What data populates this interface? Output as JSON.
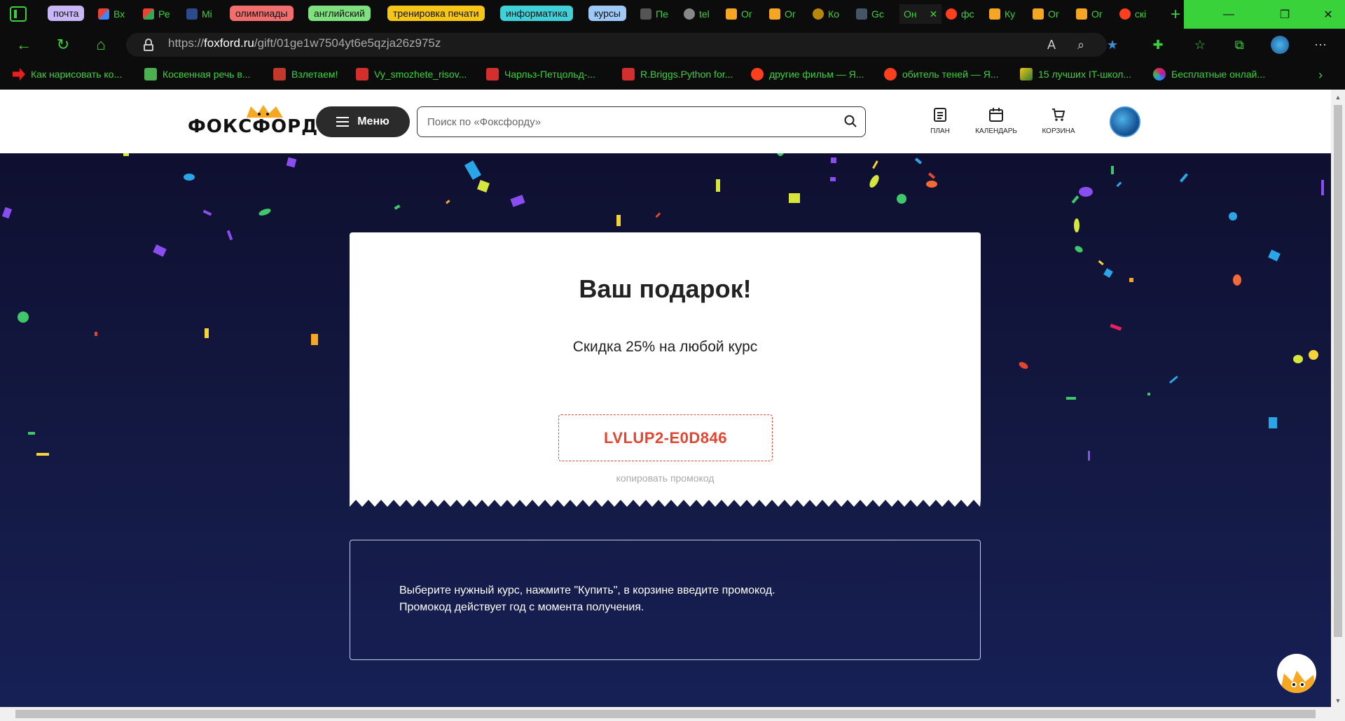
{
  "browser": {
    "tab_groups": [
      {
        "label": "почта",
        "color": "#c8b6f5"
      },
      {
        "label": "олимпиады",
        "color": "#f06e6e"
      },
      {
        "label": "английский",
        "color": "#7fe07f"
      },
      {
        "label": "тренировка печати",
        "color": "#f5c518"
      },
      {
        "label": "информатика",
        "color": "#3fd0d8"
      },
      {
        "label": "курсы",
        "color": "#9ec8f5"
      }
    ],
    "tabs": [
      {
        "label": "Вх",
        "icon": "gmail-icon"
      },
      {
        "label": "Ре",
        "icon": "gmail-icon"
      },
      {
        "label": "Мі",
        "icon": "site-icon"
      },
      {
        "label": "Пе",
        "icon": "page-icon"
      },
      {
        "label": "tel",
        "icon": "link-icon"
      },
      {
        "label": "Ог",
        "icon": "foxford-icon"
      },
      {
        "label": "Ог",
        "icon": "foxford-icon"
      },
      {
        "label": "Ко",
        "icon": "infinity-icon"
      },
      {
        "label": "Gc",
        "icon": "page-icon"
      },
      {
        "label": "Он",
        "icon": "active-tab"
      },
      {
        "label": "фс",
        "icon": "yandex-icon"
      },
      {
        "label": "Ку",
        "icon": "foxford-icon"
      },
      {
        "label": "Ог",
        "icon": "foxford-icon"
      },
      {
        "label": "Ог",
        "icon": "foxford-icon"
      },
      {
        "label": "скі",
        "icon": "yandex-icon"
      }
    ],
    "url_prefix": "https://",
    "url_domain": "foxford.ru",
    "url_path": "/gift/01ge1w7504yt6e5qzja26z975z",
    "bookmarks": [
      {
        "label": "Как нарисовать ко...",
        "icon": "red-arrow-icon"
      },
      {
        "label": "Косвенная речь в...",
        "icon": "ed-icon"
      },
      {
        "label": "Взлетаем!",
        "icon": "grid-icon"
      },
      {
        "label": "Vy_smozhete_risov...",
        "icon": "pdf-icon"
      },
      {
        "label": "Чарльз-Петцольд-...",
        "icon": "pdf-icon"
      },
      {
        "label": "R.Briggs.Python for...",
        "icon": "pdf-icon"
      },
      {
        "label": "другие фильм — Я...",
        "icon": "yandex-icon"
      },
      {
        "label": "обитель теней — Я...",
        "icon": "yandex-icon"
      },
      {
        "label": "15 лучших IT-школ...",
        "icon": "feather-icon"
      },
      {
        "label": "Бесплатные онлай...",
        "icon": "colorful-icon"
      }
    ]
  },
  "site": {
    "logo_text": "ФОКСФОРД",
    "menu_label": "Меню",
    "search_placeholder": "Поиск по «Фоксфорду»",
    "header_items": {
      "plan": "ПЛАН",
      "calendar": "КАЛЕНДАРЬ",
      "cart": "КОРЗИНА"
    }
  },
  "gift": {
    "title": "Ваш подарок!",
    "subtitle": "Скидка 25% на любой курс",
    "promo_code": "LVLUP2-E0D846",
    "copy_label": "копировать промокод",
    "accent_color": "#e34530"
  },
  "info": {
    "line1": "Выберите нужный курс, нажмите \"Купить\", в корзине введите промокод.",
    "line2": "Промокод действует год с момента получения."
  }
}
